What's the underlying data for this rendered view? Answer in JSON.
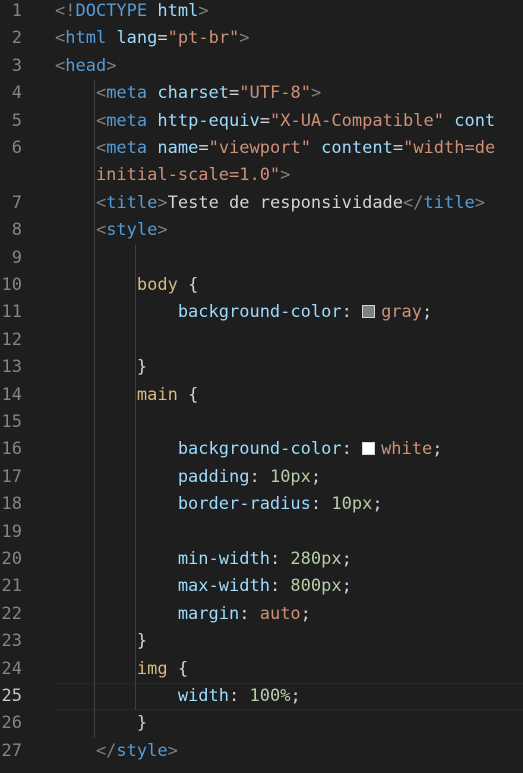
{
  "editor": {
    "active_line": "25",
    "lines": [
      {
        "n": "1",
        "tokens": [
          {
            "t": "<!",
            "c": "t-punct"
          },
          {
            "t": "DOCTYPE",
            "c": "t-tag"
          },
          {
            "t": " html",
            "c": "t-attr"
          },
          {
            "t": ">",
            "c": "t-punct"
          }
        ]
      },
      {
        "n": "2",
        "tokens": [
          {
            "t": "<",
            "c": "t-punct"
          },
          {
            "t": "html",
            "c": "t-tag"
          },
          {
            "t": " lang",
            "c": "t-attr"
          },
          {
            "t": "=",
            "c": "t-text"
          },
          {
            "t": "\"pt-br\"",
            "c": "t-str"
          },
          {
            "t": ">",
            "c": "t-punct"
          }
        ]
      },
      {
        "n": "3",
        "tokens": [
          {
            "t": "<",
            "c": "t-punct"
          },
          {
            "t": "head",
            "c": "t-tag"
          },
          {
            "t": ">",
            "c": "t-punct"
          }
        ]
      },
      {
        "n": "4",
        "tokens": [
          {
            "t": "    <",
            "c": "t-punct"
          },
          {
            "t": "meta",
            "c": "t-tag"
          },
          {
            "t": " charset",
            "c": "t-attr"
          },
          {
            "t": "=",
            "c": "t-text"
          },
          {
            "t": "\"UTF-8\"",
            "c": "t-str"
          },
          {
            "t": ">",
            "c": "t-punct"
          }
        ]
      },
      {
        "n": "5",
        "tokens": [
          {
            "t": "    <",
            "c": "t-punct"
          },
          {
            "t": "meta",
            "c": "t-tag"
          },
          {
            "t": " http-equiv",
            "c": "t-attr"
          },
          {
            "t": "=",
            "c": "t-text"
          },
          {
            "t": "\"X-UA-Compatible\"",
            "c": "t-str"
          },
          {
            "t": " cont",
            "c": "t-attr"
          }
        ]
      },
      {
        "n": "6",
        "tokens": [
          {
            "t": "    <",
            "c": "t-punct"
          },
          {
            "t": "meta",
            "c": "t-tag"
          },
          {
            "t": " name",
            "c": "t-attr"
          },
          {
            "t": "=",
            "c": "t-text"
          },
          {
            "t": "\"viewport\"",
            "c": "t-str"
          },
          {
            "t": " content",
            "c": "t-attr"
          },
          {
            "t": "=",
            "c": "t-text"
          },
          {
            "t": "\"width=de",
            "c": "t-str"
          }
        ]
      },
      {
        "n": "",
        "tokens": [
          {
            "t": "    initial-scale=1.0\"",
            "c": "t-str"
          },
          {
            "t": ">",
            "c": "t-punct"
          }
        ]
      },
      {
        "n": "7",
        "tokens": [
          {
            "t": "    <",
            "c": "t-punct"
          },
          {
            "t": "title",
            "c": "t-tag"
          },
          {
            "t": ">",
            "c": "t-punct"
          },
          {
            "t": "Teste de responsividade",
            "c": "t-text"
          },
          {
            "t": "</",
            "c": "t-punct"
          },
          {
            "t": "title",
            "c": "t-tag"
          },
          {
            "t": ">",
            "c": "t-punct"
          }
        ]
      },
      {
        "n": "8",
        "tokens": [
          {
            "t": "    <",
            "c": "t-punct"
          },
          {
            "t": "style",
            "c": "t-tag"
          },
          {
            "t": ">",
            "c": "t-punct"
          }
        ]
      },
      {
        "n": "9",
        "tokens": []
      },
      {
        "n": "10",
        "tokens": [
          {
            "t": "        body",
            "c": "t-sel"
          },
          {
            "t": " {",
            "c": "t-text"
          }
        ]
      },
      {
        "n": "11",
        "tokens": [
          {
            "t": "            background-color",
            "c": "t-prop"
          },
          {
            "t": ": ",
            "c": "t-text"
          },
          {
            "swatch": "#808080"
          },
          {
            "t": "gray",
            "c": "t-val"
          },
          {
            "t": ";",
            "c": "t-text"
          }
        ]
      },
      {
        "n": "12",
        "tokens": []
      },
      {
        "n": "13",
        "tokens": [
          {
            "t": "        }",
            "c": "t-text"
          }
        ]
      },
      {
        "n": "14",
        "tokens": [
          {
            "t": "        main",
            "c": "t-sel"
          },
          {
            "t": " {",
            "c": "t-text"
          }
        ]
      },
      {
        "n": "15",
        "tokens": []
      },
      {
        "n": "16",
        "tokens": [
          {
            "t": "            background-color",
            "c": "t-prop"
          },
          {
            "t": ": ",
            "c": "t-text"
          },
          {
            "swatch": "#ffffff"
          },
          {
            "t": "white",
            "c": "t-val"
          },
          {
            "t": ";",
            "c": "t-text"
          }
        ]
      },
      {
        "n": "17",
        "tokens": [
          {
            "t": "            padding",
            "c": "t-prop"
          },
          {
            "t": ": ",
            "c": "t-text"
          },
          {
            "t": "10px",
            "c": "t-num"
          },
          {
            "t": ";",
            "c": "t-text"
          }
        ]
      },
      {
        "n": "18",
        "tokens": [
          {
            "t": "            border-radius",
            "c": "t-prop"
          },
          {
            "t": ": ",
            "c": "t-text"
          },
          {
            "t": "10px",
            "c": "t-num"
          },
          {
            "t": ";",
            "c": "t-text"
          }
        ]
      },
      {
        "n": "19",
        "tokens": []
      },
      {
        "n": "20",
        "tokens": [
          {
            "t": "            min-width",
            "c": "t-prop"
          },
          {
            "t": ": ",
            "c": "t-text"
          },
          {
            "t": "280px",
            "c": "t-num"
          },
          {
            "t": ";",
            "c": "t-text"
          }
        ]
      },
      {
        "n": "21",
        "tokens": [
          {
            "t": "            max-width",
            "c": "t-prop"
          },
          {
            "t": ": ",
            "c": "t-text"
          },
          {
            "t": "800px",
            "c": "t-num"
          },
          {
            "t": ";",
            "c": "t-text"
          }
        ]
      },
      {
        "n": "22",
        "tokens": [
          {
            "t": "            margin",
            "c": "t-prop"
          },
          {
            "t": ": ",
            "c": "t-text"
          },
          {
            "t": "auto",
            "c": "t-val"
          },
          {
            "t": ";",
            "c": "t-text"
          }
        ]
      },
      {
        "n": "23",
        "tokens": [
          {
            "t": "        }",
            "c": "t-text"
          }
        ]
      },
      {
        "n": "24",
        "tokens": [
          {
            "t": "        img",
            "c": "t-sel"
          },
          {
            "t": " {",
            "c": "t-text"
          }
        ]
      },
      {
        "n": "25",
        "tokens": [
          {
            "t": "            width",
            "c": "t-prop"
          },
          {
            "t": ": ",
            "c": "t-text"
          },
          {
            "t": "100%",
            "c": "t-num"
          },
          {
            "t": ";",
            "c": "t-text"
          }
        ]
      },
      {
        "n": "26",
        "tokens": [
          {
            "t": "        }",
            "c": "t-text"
          }
        ]
      },
      {
        "n": "27",
        "tokens": [
          {
            "t": "    </",
            "c": "t-punct"
          },
          {
            "t": "style",
            "c": "t-tag"
          },
          {
            "t": ">",
            "c": "t-punct"
          }
        ]
      }
    ]
  }
}
